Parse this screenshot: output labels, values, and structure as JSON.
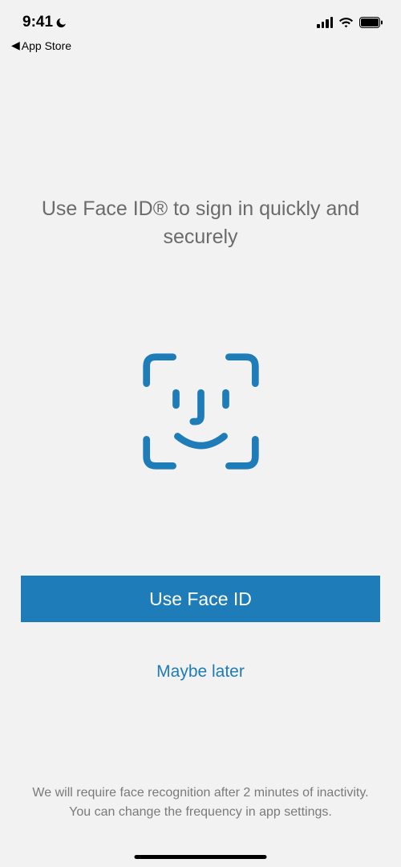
{
  "status_bar": {
    "time": "9:41",
    "back_label": "App Store"
  },
  "content": {
    "heading": "Use Face ID® to sign in quickly and securely",
    "primary_button_label": "Use Face ID",
    "secondary_button_label": "Maybe later",
    "footer_text": "We will require face recognition after 2 minutes of inactivity. You can change the frequency in app settings."
  },
  "colors": {
    "accent": "#1e7cb8",
    "background": "#f2f2f2",
    "text_muted": "#6b6b6b"
  }
}
